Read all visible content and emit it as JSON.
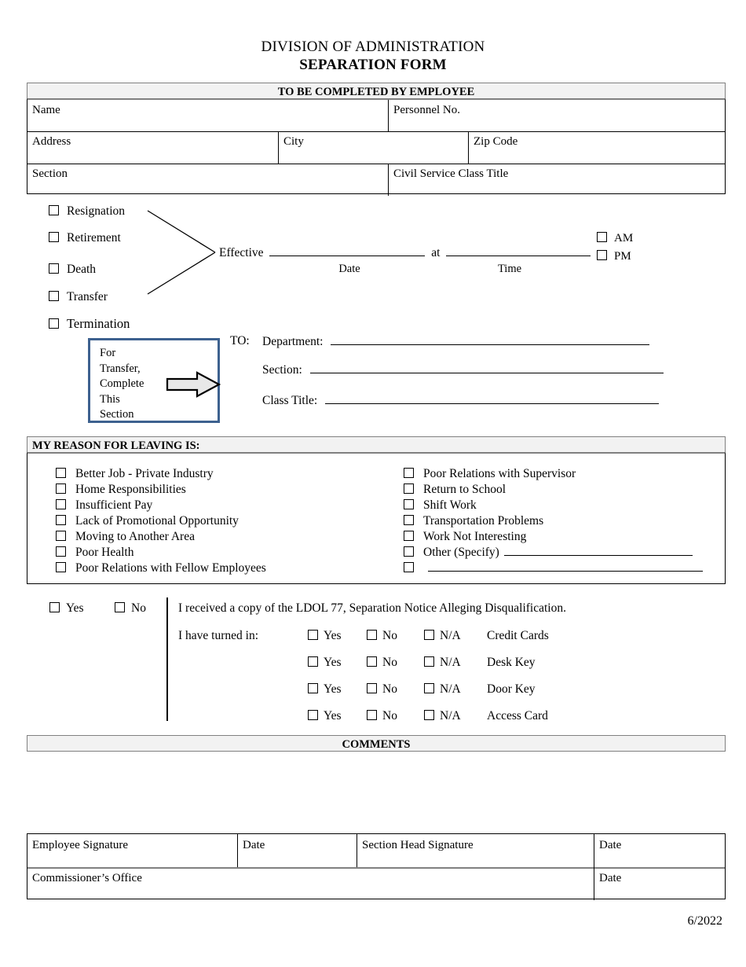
{
  "document": {
    "title_line1": "DIVISION OF ADMINISTRATION",
    "title_line2": "SEPARATION FORM",
    "footer_revision": "6/2022"
  },
  "employee_section": {
    "header": "TO BE COMPLETED BY EMPLOYEE",
    "fields": {
      "name": "Name",
      "personnel_no": "Personnel No.",
      "address": "Address",
      "city": "City",
      "zip_code": "Zip Code",
      "section": "Section",
      "civil_service_class_title": "Civil Service Class Title"
    }
  },
  "separation_types": [
    {
      "label": "Resignation"
    },
    {
      "label": "Retirement"
    },
    {
      "label": "Death"
    },
    {
      "label": "Transfer"
    },
    {
      "label": "Termination"
    }
  ],
  "effective": {
    "prefix": "Effective",
    "conjunction": "at",
    "date_sublabel": "Date",
    "time_sublabel": "Time",
    "am_label": "AM",
    "pm_label": "PM"
  },
  "transfer_box": {
    "lines": [
      "For",
      "Transfer,",
      "Complete",
      "This",
      "Section"
    ],
    "border_color": "#3d618f",
    "arrow_fill": "#e8e8e8"
  },
  "transfer_to": {
    "to_label": "TO:",
    "rows": [
      {
        "label": "Department:"
      },
      {
        "label": "Section:"
      },
      {
        "label": "Class Title:"
      }
    ]
  },
  "reason_section": {
    "header": "MY REASON FOR LEAVING IS:",
    "left_column": [
      "Better Job - Private Industry",
      "Home Responsibilities",
      "Insufficient Pay",
      "Lack of Promotional Opportunity",
      "Moving to Another Area",
      "Poor Health",
      "Poor Relations with Fellow Employees"
    ],
    "right_column": [
      "Poor Relations with Supervisor",
      "Return to School",
      "Shift Work",
      "Transportation Problems",
      "Work Not Interesting",
      "Other (Specify)",
      ""
    ]
  },
  "receipt_section": {
    "yes_label": "Yes",
    "no_label": "No",
    "na_label": "N/A",
    "statement": "I received a copy of the LDOL 77, Separation Notice Alleging Disqualification.",
    "turned_in_label": "I have turned in:",
    "items": [
      "Credit Cards",
      "Desk Key",
      "Door Key",
      "Access Card"
    ]
  },
  "comments_section": {
    "header": "COMMENTS"
  },
  "signature_section": {
    "employee_signature": "Employee Signature",
    "employee_date": "Date",
    "section_head_signature": "Section Head Signature",
    "section_head_date": "Date",
    "commissioners_office": "Commissioner’s Office",
    "commissioners_date": "Date"
  }
}
